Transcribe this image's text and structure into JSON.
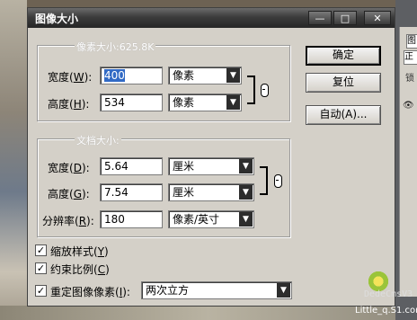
{
  "dialog": {
    "title": "图像大小",
    "controls": {
      "minimize": "—",
      "maximize": "□",
      "close": "✕"
    }
  },
  "pixel_dimensions": {
    "legend": "像素大小:625.8K",
    "width": {
      "label_pre": "宽度(",
      "key": "W",
      "label_post": "):",
      "value": "400",
      "unit": "像素"
    },
    "height": {
      "label_pre": "高度(",
      "key": "H",
      "label_post": "):",
      "value": "534",
      "unit": "像素"
    }
  },
  "document_size": {
    "legend": "文档大小:",
    "width": {
      "label_pre": "宽度(",
      "key": "D",
      "label_post": "):",
      "value": "5.64",
      "unit": "厘米"
    },
    "height": {
      "label_pre": "高度(",
      "key": "G",
      "label_post": "):",
      "value": "7.54",
      "unit": "厘米"
    },
    "resolution": {
      "label_pre": "分辨率(",
      "key": "R",
      "label_post": "):",
      "value": "180",
      "unit": "像素/英寸"
    }
  },
  "buttons": {
    "ok": "确定",
    "reset": "复位",
    "auto": "自动(A)..."
  },
  "options": {
    "scale_styles": {
      "label_pre": "缩放样式(",
      "key": "Y",
      "label_post": ")",
      "checked": true
    },
    "constrain": {
      "label_pre": "约束比例(",
      "key": "C",
      "label_post": ")",
      "checked": true
    },
    "resample": {
      "label_pre": "重定图像像素(",
      "key": "I",
      "label_post": "):",
      "checked": true,
      "method": "两次立方"
    }
  },
  "side_panel": {
    "tab": "图",
    "field": "正",
    "label": "锁"
  },
  "watermark": {
    "line1": "DedeCmsV3",
    "line2": "Little_q.S1.com"
  },
  "check_mark": "✓",
  "dropdown_arrow": "▼"
}
